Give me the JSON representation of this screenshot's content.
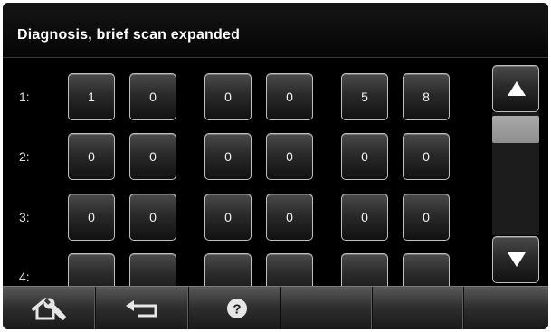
{
  "header": {
    "title": "Diagnosis, brief scan expanded"
  },
  "rows": [
    {
      "label": "1:",
      "values": [
        "1",
        "0",
        "0",
        "0",
        "5",
        "8"
      ]
    },
    {
      "label": "2:",
      "values": [
        "0",
        "0",
        "0",
        "0",
        "0",
        "0"
      ]
    },
    {
      "label": "3:",
      "values": [
        "0",
        "0",
        "0",
        "0",
        "0",
        "0"
      ]
    },
    {
      "label": "4:",
      "values": [
        "",
        "",
        "",
        "",
        "",
        ""
      ]
    }
  ],
  "scroll": {
    "up_icon": "triangle-up-icon",
    "down_icon": "triangle-down-icon"
  },
  "toolbar": {
    "buttons": [
      {
        "icon": "home-service-icon"
      },
      {
        "icon": "back-arrow-icon"
      },
      {
        "icon": "help-icon"
      },
      {
        "icon": ""
      },
      {
        "icon": ""
      },
      {
        "icon": ""
      }
    ]
  },
  "colors": {
    "background": "#000000",
    "text": "#ffffff",
    "button_border": "#bfbfbf",
    "scroll_thumb": "#999999"
  }
}
